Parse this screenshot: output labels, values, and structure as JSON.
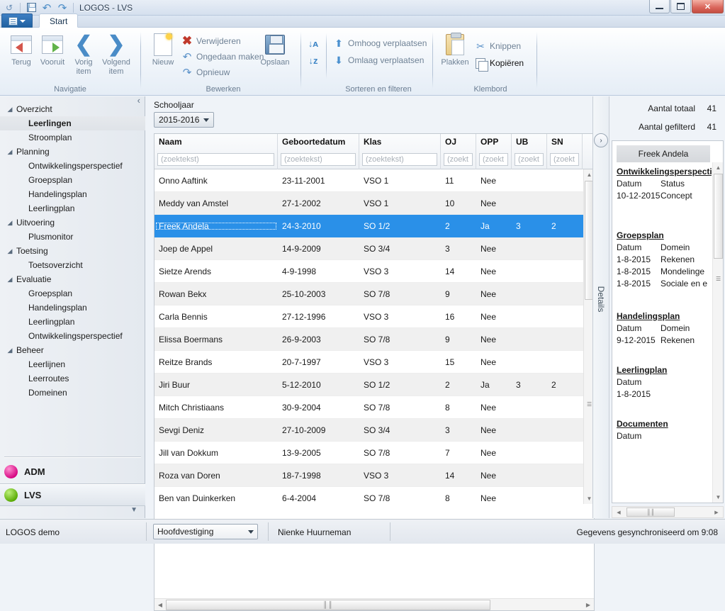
{
  "window": {
    "title": "LOGOS - LVS",
    "quick_access": [
      {
        "name": "undo-small-icon",
        "glyph": "↺"
      },
      {
        "name": "save-icon",
        "glyph": "💾"
      },
      {
        "name": "undo-icon",
        "glyph": "↶"
      },
      {
        "name": "redo-icon",
        "glyph": "↷"
      }
    ],
    "controls": {
      "minimize": "–",
      "maximize": "❐",
      "close": "✕"
    }
  },
  "ribbon": {
    "app_button": "app-menu",
    "tabs": [
      {
        "label": "Start",
        "active": true
      }
    ],
    "groups": [
      {
        "name": "Navigatie",
        "label": "Navigatie",
        "buttons": [
          {
            "label": "Terug",
            "icon": "back-arrow-icon"
          },
          {
            "label": "Vooruit",
            "icon": "forward-arrow-icon"
          },
          {
            "label": "Vorig item",
            "icon": "chevron-left-icon"
          },
          {
            "label": "Volgend item",
            "icon": "chevron-right-icon"
          }
        ]
      },
      {
        "name": "Bewerken",
        "label": "Bewerken",
        "big": [
          {
            "label": "Nieuw",
            "icon": "new-page-icon"
          },
          {
            "label": "Opslaan",
            "icon": "save-floppy-icon"
          }
        ],
        "small": [
          {
            "label": "Verwijderen",
            "icon": "delete-x-icon"
          },
          {
            "label": "Ongedaan maken",
            "icon": "undo-icon"
          },
          {
            "label": "Opnieuw",
            "icon": "redo-icon"
          }
        ]
      },
      {
        "name": "Sorteren en filteren",
        "label": "Sorteren en filteren",
        "small": [
          {
            "label": "Omhoog verplaatsen",
            "icon": "arrow-up-icon"
          },
          {
            "label": "Omlaag verplaatsen",
            "icon": "arrow-down-icon"
          }
        ],
        "sort": [
          {
            "icon": "sort-ascending-icon",
            "label": "A↓Z"
          },
          {
            "icon": "sort-descending-icon",
            "label": "Z↓A"
          }
        ]
      },
      {
        "name": "Klembord",
        "label": "Klembord",
        "big": [
          {
            "label": "Plakken",
            "icon": "clipboard-paste-icon"
          }
        ],
        "small": [
          {
            "label": "Knippen",
            "icon": "scissors-icon",
            "enabled": false
          },
          {
            "label": "Kopiëren",
            "icon": "copy-icon",
            "enabled": true
          }
        ]
      }
    ]
  },
  "sidebar": {
    "collapse_glyph": "‹",
    "tree": [
      {
        "label": "Overzicht",
        "level": 0,
        "expanded": true
      },
      {
        "label": "Leerlingen",
        "level": 1,
        "selected": true
      },
      {
        "label": "Stroomplan",
        "level": 1
      },
      {
        "label": "Planning",
        "level": 0,
        "expanded": true
      },
      {
        "label": "Ontwikkelingsperspectief",
        "level": 1
      },
      {
        "label": "Groepsplan",
        "level": 1
      },
      {
        "label": "Handelingsplan",
        "level": 1
      },
      {
        "label": "Leerlingplan",
        "level": 1
      },
      {
        "label": "Uitvoering",
        "level": 0,
        "expanded": true
      },
      {
        "label": "Plusmonitor",
        "level": 1
      },
      {
        "label": "Toetsing",
        "level": 0,
        "expanded": true
      },
      {
        "label": "Toetsoverzicht",
        "level": 1
      },
      {
        "label": "Evaluatie",
        "level": 0,
        "expanded": true
      },
      {
        "label": "Groepsplan",
        "level": 1
      },
      {
        "label": "Handelingsplan",
        "level": 1
      },
      {
        "label": "Leerlingplan",
        "level": 1
      },
      {
        "label": "Ontwikkelingsperspectief",
        "level": 1
      },
      {
        "label": "Beheer",
        "level": 0,
        "expanded": true
      },
      {
        "label": "Leerlijnen",
        "level": 1
      },
      {
        "label": "Leerroutes",
        "level": 1
      },
      {
        "label": "Domeinen",
        "level": 1
      }
    ],
    "modules": [
      {
        "label": "ADM",
        "color": "#d4007f",
        "selected": false
      },
      {
        "label": "LVS",
        "color": "#56a800",
        "selected": true
      }
    ],
    "more_glyph": "▼"
  },
  "main": {
    "schooljaar_label": "Schooljaar",
    "schooljaar_value": "2015-2016",
    "columns": [
      {
        "key": "naam",
        "title": "Naam",
        "filter_placeholder": "(zoektekst)",
        "width": 174
      },
      {
        "key": "geboortedatum",
        "title": "Geboortedatum",
        "filter_placeholder": "(zoektekst)",
        "width": 115
      },
      {
        "key": "klas",
        "title": "Klas",
        "filter_placeholder": "(zoektekst)",
        "width": 115
      },
      {
        "key": "oj",
        "title": "OJ",
        "filter_placeholder": "(zoekt",
        "width": 50
      },
      {
        "key": "opp",
        "title": "OPP",
        "filter_placeholder": "(zoekt",
        "width": 50
      },
      {
        "key": "ub",
        "title": "UB",
        "filter_placeholder": "(zoekt",
        "width": 50
      },
      {
        "key": "sn",
        "title": "SN",
        "filter_placeholder": "(zoekt",
        "width": 50
      }
    ],
    "rows": [
      {
        "naam": "Onno Aaftink",
        "geboortedatum": "23-11-2001",
        "klas": "VSO 1",
        "oj": "11",
        "opp": "Nee",
        "ub": "",
        "sn": "",
        "selected": false
      },
      {
        "naam": "Meddy van Amstel",
        "geboortedatum": "27-1-2002",
        "klas": "VSO 1",
        "oj": "10",
        "opp": "Nee",
        "ub": "",
        "sn": "",
        "selected": false
      },
      {
        "naam": "Freek Andela",
        "geboortedatum": "24-3-2010",
        "klas": "SO 1/2",
        "oj": "2",
        "opp": "Ja",
        "ub": "3",
        "sn": "2",
        "selected": true
      },
      {
        "naam": "Joep de Appel",
        "geboortedatum": "14-9-2009",
        "klas": "SO 3/4",
        "oj": "3",
        "opp": "Nee",
        "ub": "",
        "sn": "",
        "selected": false
      },
      {
        "naam": "Sietze Arends",
        "geboortedatum": "4-9-1998",
        "klas": "VSO 3",
        "oj": "14",
        "opp": "Nee",
        "ub": "",
        "sn": "",
        "selected": false
      },
      {
        "naam": "Rowan Bekx",
        "geboortedatum": "25-10-2003",
        "klas": "SO 7/8",
        "oj": "9",
        "opp": "Nee",
        "ub": "",
        "sn": "",
        "selected": false
      },
      {
        "naam": "Carla Bennis",
        "geboortedatum": "27-12-1996",
        "klas": "VSO 3",
        "oj": "16",
        "opp": "Nee",
        "ub": "",
        "sn": "",
        "selected": false
      },
      {
        "naam": "Elissa Boermans",
        "geboortedatum": "26-9-2003",
        "klas": "SO 7/8",
        "oj": "9",
        "opp": "Nee",
        "ub": "",
        "sn": "",
        "selected": false
      },
      {
        "naam": "Reitze Brands",
        "geboortedatum": "20-7-1997",
        "klas": "VSO 3",
        "oj": "15",
        "opp": "Nee",
        "ub": "",
        "sn": "",
        "selected": false
      },
      {
        "naam": "Jiri Buur",
        "geboortedatum": "5-12-2010",
        "klas": "SO 1/2",
        "oj": "2",
        "opp": "Ja",
        "ub": "3",
        "sn": "2",
        "selected": false
      },
      {
        "naam": "Mitch Christiaans",
        "geboortedatum": "30-9-2004",
        "klas": "SO 7/8",
        "oj": "8",
        "opp": "Nee",
        "ub": "",
        "sn": "",
        "selected": false
      },
      {
        "naam": "Sevgi Deniz",
        "geboortedatum": "27-10-2009",
        "klas": "SO 3/4",
        "oj": "3",
        "opp": "Nee",
        "ub": "",
        "sn": "",
        "selected": false
      },
      {
        "naam": "Jill van Dokkum",
        "geboortedatum": "13-9-2005",
        "klas": "SO 7/8",
        "oj": "7",
        "opp": "Nee",
        "ub": "",
        "sn": "",
        "selected": false
      },
      {
        "naam": "Roza van Doren",
        "geboortedatum": "18-7-1998",
        "klas": "VSO 3",
        "oj": "14",
        "opp": "Nee",
        "ub": "",
        "sn": "",
        "selected": false
      },
      {
        "naam": "Ben van Duinkerken",
        "geboortedatum": "6-4-2004",
        "klas": "SO 7/8",
        "oj": "8",
        "opp": "Nee",
        "ub": "",
        "sn": "",
        "selected": false
      }
    ]
  },
  "details_tab": {
    "label": "Details",
    "expand_glyph": "›"
  },
  "right": {
    "counts": [
      {
        "label": "Aantal totaal",
        "value": "41"
      },
      {
        "label": "Aantal gefilterd",
        "value": "41"
      }
    ],
    "selected_name": "Freek Andela",
    "sections": [
      {
        "title": "Ontwikkelingsperspecti",
        "headers": [
          "Datum",
          "Status"
        ],
        "rows": [
          [
            "10-12-2015",
            "Concept"
          ]
        ]
      },
      {
        "title": "Groepsplan",
        "headers": [
          "Datum",
          "Domein"
        ],
        "rows": [
          [
            "1-8-2015",
            "Rekenen"
          ],
          [
            "1-8-2015",
            "Mondelinge"
          ],
          [
            "1-8-2015",
            "Sociale en e"
          ]
        ]
      },
      {
        "title": "Handelingsplan",
        "headers": [
          "Datum",
          "Domein"
        ],
        "rows": [
          [
            "9-12-2015",
            "Rekenen"
          ]
        ]
      },
      {
        "title": "Leerlingplan",
        "headers": [
          "Datum",
          ""
        ],
        "rows": [
          [
            "1-8-2015",
            ""
          ]
        ]
      },
      {
        "title": "Documenten",
        "headers": [
          "Datum",
          ""
        ],
        "rows": []
      }
    ]
  },
  "statusbar": {
    "app": "LOGOS demo",
    "location": "Hoofdvestiging",
    "user": "Nienke Huurneman",
    "sync": "Gegevens gesynchroniseerd om 9:08"
  },
  "colors": {
    "selection_blue": "#2a90e8",
    "accent_blue": "#1f5f9e",
    "adm_pink": "#d4007f",
    "lvs_green": "#56a800"
  }
}
